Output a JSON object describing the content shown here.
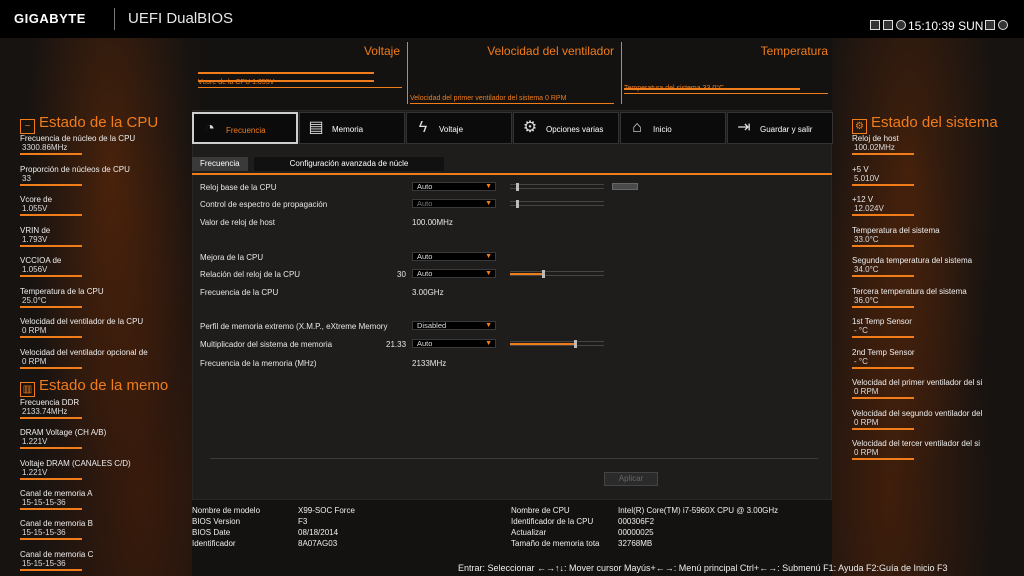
{
  "header": {
    "brand": "GIGABYTE",
    "product": "UEFI DualBIOS",
    "time": "15:10:39",
    "day": "SUN"
  },
  "monitors": [
    {
      "title": "Voltaje",
      "label": "Vcore de la CPU     1.055V"
    },
    {
      "title": "Velocidad del ventilador",
      "label": "Velocidad del primer ventilador del sistema       0 RPM"
    },
    {
      "title": "Temperatura",
      "label": "Temperatura del sistema        33.0°C"
    }
  ],
  "cpu_status": {
    "title": "Estado de la CPU",
    "items": [
      {
        "k": "Frecuencia de núcleo de la CPU",
        "v": "3300.86MHz"
      },
      {
        "k": "Proporción de núcleos de CPU",
        "v": "33"
      },
      {
        "k": "Vcore de",
        "v": "1.055V"
      },
      {
        "k": "VRIN de",
        "v": "1.793V"
      },
      {
        "k": "VCCIOA de",
        "v": "1.056V"
      },
      {
        "k": "Temperatura de la CPU",
        "v": "25.0°C"
      },
      {
        "k": "Velocidad del ventilador de la CPU",
        "v": "0 RPM"
      },
      {
        "k": "Velocidad del ventilador opcional de",
        "v": "0 RPM"
      }
    ]
  },
  "mem_status": {
    "title": "Estado de la memo",
    "items": [
      {
        "k": "Frecuencia DDR",
        "v": "2133.74MHz"
      },
      {
        "k": "DRAM Voltage     (CH A/B)",
        "v": "1.221V"
      },
      {
        "k": "Voltaje DRAM (CANALES C/D)",
        "v": "1.221V"
      },
      {
        "k": "Canal de memoria A",
        "v": "15-15-15-36"
      },
      {
        "k": "Canal de memoria B",
        "v": "15-15-15-36"
      },
      {
        "k": "Canal de memoria C",
        "v": "15-15-15-36"
      }
    ]
  },
  "sys_status": {
    "title": "Estado del sistema",
    "items": [
      {
        "k": "Reloj de host",
        "v": "100.02MHz"
      },
      {
        "k": "+5 V",
        "v": "5.010V"
      },
      {
        "k": "+12 V",
        "v": "12.024V"
      },
      {
        "k": "Temperatura del sistema",
        "v": "33.0°C"
      },
      {
        "k": "Segunda temperatura del sistema",
        "v": "34.0°C"
      },
      {
        "k": "Tercera temperatura del sistema",
        "v": "36.0°C"
      },
      {
        "k": "1st Temp Sensor",
        "v": "- °C"
      },
      {
        "k": "2nd Temp Sensor",
        "v": "- °C"
      },
      {
        "k": "Velocidad del primer ventilador del si",
        "v": "0 RPM"
      },
      {
        "k": "Velocidad del segundo ventilador del",
        "v": "0 RPM"
      },
      {
        "k": "Velocidad del tercer ventilador del si",
        "v": "0 RPM"
      }
    ]
  },
  "tabs": [
    {
      "label": "Frecuencia",
      "icon": "speedometer-icon"
    },
    {
      "label": "Memoria",
      "icon": "memory-icon"
    },
    {
      "label": "Voltaje",
      "icon": "bolt-icon"
    },
    {
      "label": "Opciones varias",
      "icon": "gear-icon"
    },
    {
      "label": "Inicio",
      "icon": "home-icon"
    },
    {
      "label": "Guardar y salir",
      "icon": "exit-icon"
    }
  ],
  "subtabs": [
    "Frecuencia",
    "Configuración avanzada de núcle"
  ],
  "settings": {
    "base_clock": {
      "label": "Reloj base de la CPU",
      "value": "Auto"
    },
    "spread": {
      "label": "Control de espectro de propagación",
      "value": "Auto"
    },
    "host_clock": {
      "label": "Valor de reloj de host",
      "value": "100.00MHz"
    },
    "cpu_upgrade": {
      "label": "Mejora de la CPU",
      "value": "Auto"
    },
    "ratio": {
      "label": "Relación del reloj de la CPU",
      "num": "30",
      "value": "Auto"
    },
    "cpu_freq": {
      "label": "Frecuencia de la CPU",
      "value": "3.00GHz"
    },
    "xmp": {
      "label": "Perfil de memoria extremo (X.M.P., eXtreme Memory",
      "value": "Disabled"
    },
    "mult": {
      "label": "Multiplicador del sistema de memoria",
      "num": "21.33",
      "value": "Auto"
    },
    "memfreq": {
      "label": "Frecuencia de la memoria (MHz)",
      "value": "2133MHz"
    }
  },
  "apply_label": "Aplicar",
  "sysinfo": {
    "model_k": "Nombre de modelo",
    "model_v": "X99-SOC Force",
    "biosv_k": "BIOS Version",
    "biosv_v": "F3",
    "biosd_k": "BIOS Date",
    "biosd_v": "08/18/2014",
    "id_k": "Identificador",
    "id_v": "8A07AG03",
    "cpu_k": "Nombre de CPU",
    "cpu_v": "Intel(R) Core(TM) i7-5960X CPU @ 3.00GHz",
    "cpuid_k": "Identificador de la CPU",
    "cpuid_v": "000306F2",
    "upd_k": "Actualizar",
    "upd_v": "00000025",
    "memsz_k": "Tamaño de memoria tota",
    "memsz_v": "32768MB"
  },
  "help": "Entrar: Seleccionar ←→↑↓: Mover cursor Mayús+←→: Menú principal Ctrl+←→: Submenú F1: Ayuda F2:Guía de Inicio F3"
}
